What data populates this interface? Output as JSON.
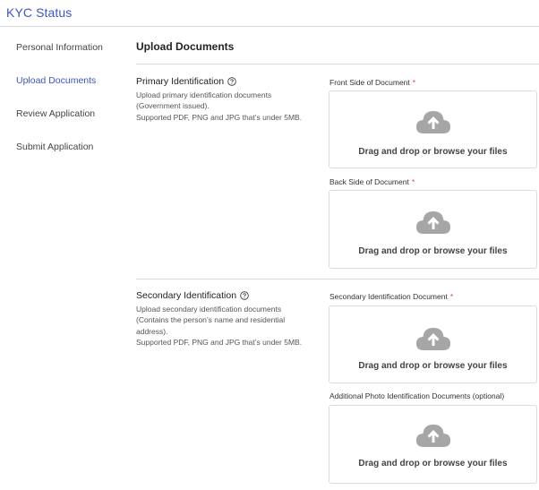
{
  "header": {
    "title": "KYC Status"
  },
  "sidebar": {
    "items": [
      {
        "label": "Personal Information",
        "active": false
      },
      {
        "label": "Upload Documents",
        "active": true
      },
      {
        "label": "Review Application",
        "active": false
      },
      {
        "label": "Submit Application",
        "active": false
      }
    ]
  },
  "main": {
    "heading": "Upload Documents",
    "primary": {
      "title": "Primary Identification",
      "desc": [
        "Upload primary identification documents",
        "(Government issued).",
        "Supported PDF, PNG and JPG that’s under 5MB."
      ],
      "fields": [
        {
          "label": "Front Side of Document",
          "required": "*",
          "dropzone_text": "Drag and drop or browse your files"
        },
        {
          "label": "Back Side of Document",
          "required": "*",
          "dropzone_text": "Drag and drop or browse your files"
        }
      ]
    },
    "secondary": {
      "title": "Secondary Identification",
      "desc": [
        "Upload secondary identification documents",
        "(Contains the person’s name and residential",
        "address).",
        "Supported PDF, PNG and JPG that’s under 5MB."
      ],
      "fields": [
        {
          "label": "Secondary Identification Document",
          "required": "*",
          "dropzone_text": "Drag and drop or browse your files"
        },
        {
          "label": "Additional Photo Identification Documents (optional)",
          "required": "",
          "dropzone_text": "Drag and drop or browse your files"
        }
      ]
    }
  },
  "colors": {
    "accent": "#3d55c9",
    "required": "#e04444",
    "icon": "#a6a6a6",
    "border": "#dcdcdc"
  },
  "icons": {
    "help": "help-circle-icon",
    "upload": "cloud-upload-icon"
  }
}
